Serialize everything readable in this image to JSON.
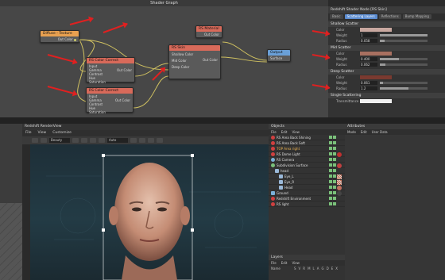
{
  "shader_graph": {
    "title": "Shader Graph",
    "nodes": {
      "diffuse_texture": {
        "title": "Diffuse - Texture",
        "port_out": "Out Color"
      },
      "rs_material": {
        "title": "RS Material",
        "port_out": "Out Color"
      },
      "rs_color_correct_1": {
        "title": "RS Color Correct",
        "ports_in": [
          "Input",
          "Gamma",
          "Contrast",
          "Hue",
          "Saturation"
        ],
        "port_out": "Out Color"
      },
      "rs_color_correct_2": {
        "title": "RS Color Correct",
        "ports_in": [
          "Input",
          "Gamma",
          "Contrast",
          "Hue",
          "Saturation"
        ],
        "port_out": "Out Color"
      },
      "rs_skin": {
        "title": "RS Skin",
        "ports_in": [
          "Shallow Color",
          "Mid Color",
          "Deep Color"
        ],
        "port_out": "Out Color"
      },
      "output": {
        "title": "Output",
        "port_in": "Surface"
      }
    },
    "accent_colors": {
      "arrow": "#e02020",
      "node_orange": "#e8a050",
      "node_red": "#d86a5a",
      "node_blue": "#6aa0d8"
    }
  },
  "attr_top": {
    "title": "Redshift Shader Node [RS Skin]",
    "tabs": [
      "Basic",
      "Scattering Layers",
      "Reflections",
      "Bump Mapping"
    ],
    "active_tab": "Scattering Layers",
    "sections": [
      {
        "name": "Shallow Scatter",
        "rows": [
          {
            "label": "Color",
            "value": ""
          },
          {
            "label": "Weight",
            "value": "1",
            "fraction": 1.0
          },
          {
            "label": "Radius",
            "value": "0.058",
            "fraction": 0.1
          }
        ]
      },
      {
        "name": "Mid Scatter",
        "rows": [
          {
            "label": "Color",
            "value": ""
          },
          {
            "label": "Weight",
            "value": "0.400",
            "fraction": 0.4
          },
          {
            "label": "Radius",
            "value": "0.062",
            "fraction": 0.12
          }
        ]
      },
      {
        "name": "Deep Scatter",
        "rows": [
          {
            "label": "Color",
            "value": ""
          },
          {
            "label": "Weight",
            "value": "0.061",
            "fraction": 0.06
          },
          {
            "label": "Radius",
            "value": "1.2",
            "fraction": 0.6
          }
        ]
      },
      {
        "name": "Single Scattering",
        "rows": [
          {
            "label": "Transmittance",
            "value": ""
          }
        ]
      }
    ]
  },
  "render_view": {
    "title": "Redshift RenderView",
    "menu": [
      "File",
      "View",
      "Customize"
    ],
    "toolbar_select": "Beauty",
    "toolbar_select2": "Auto"
  },
  "objects": {
    "title": "Objects",
    "menu": [
      "File",
      "Edit",
      "View"
    ],
    "items": [
      "RS Area Back Shining",
      "RS Area Back Soft",
      "TOP Area right",
      "RS Dome Light",
      "RS Camera",
      "Subdivision Surface",
      "head",
      "Eye_L",
      "Eye_R",
      "Head",
      "Ground",
      "Redshift Environment",
      "RS light"
    ]
  },
  "attributes": {
    "title": "Attributes",
    "menu": [
      "Mode",
      "Edit",
      "User Data"
    ]
  },
  "layers": {
    "title": "Layers",
    "menu": [
      "File",
      "Edit",
      "View"
    ],
    "col_name": "Name",
    "flags": [
      "S",
      "V",
      "R",
      "M",
      "L",
      "A",
      "G",
      "D",
      "E",
      "X"
    ]
  }
}
